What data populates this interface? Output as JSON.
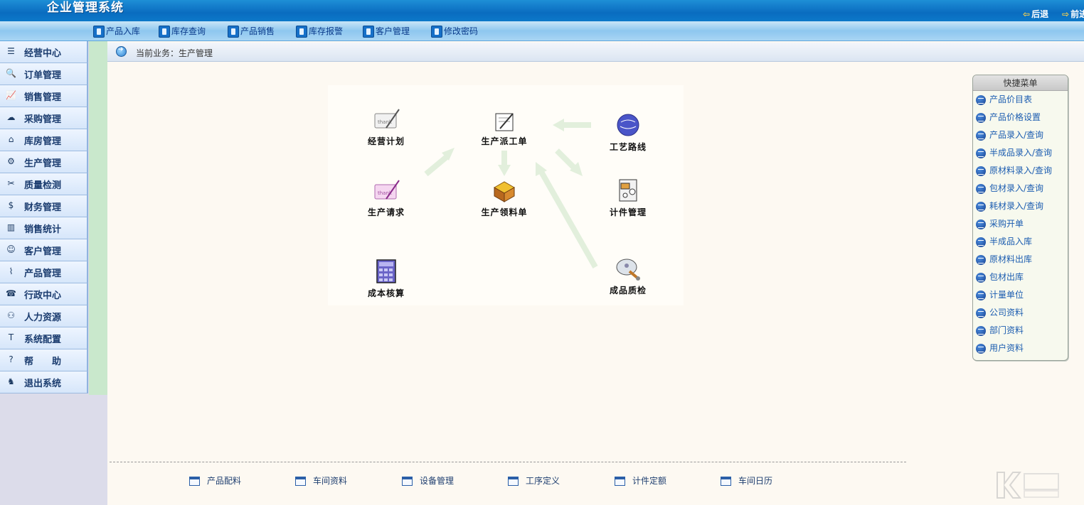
{
  "header": {
    "app_title": "企业管理系统",
    "back_label": "后退",
    "forward_label": "前进"
  },
  "toolbar": {
    "items": [
      {
        "label": "产品入库",
        "icon": "document-icon"
      },
      {
        "label": "库存查询",
        "icon": "users-icon"
      },
      {
        "label": "产品销售",
        "icon": "document-icon"
      },
      {
        "label": "库存报警",
        "icon": "document-icon"
      },
      {
        "label": "客户管理",
        "icon": "users-icon"
      },
      {
        "label": "修改密码",
        "icon": "key-icon"
      }
    ]
  },
  "sidebar": {
    "items": [
      {
        "label": "经营中心",
        "icon": "☰"
      },
      {
        "label": "订单管理",
        "icon": "🔍"
      },
      {
        "label": "销售管理",
        "icon": "📈"
      },
      {
        "label": "采购管理",
        "icon": "☁"
      },
      {
        "label": "库房管理",
        "icon": "⌂"
      },
      {
        "label": "生产管理",
        "icon": "⚙"
      },
      {
        "label": "质量检测",
        "icon": "✂"
      },
      {
        "label": "财务管理",
        "icon": "$"
      },
      {
        "label": "销售统计",
        "icon": "▥"
      },
      {
        "label": "客户管理",
        "icon": "☺"
      },
      {
        "label": "产品管理",
        "icon": "⌇"
      },
      {
        "label": "行政中心",
        "icon": "☎"
      },
      {
        "label": "人力资源",
        "icon": "⚇"
      },
      {
        "label": "系统配置",
        "icon": "T"
      },
      {
        "label": "帮　　助",
        "icon": "?"
      },
      {
        "label": "退出系统",
        "icon": "♞"
      }
    ]
  },
  "breadcrumb": {
    "text": "当前业务：生产管理"
  },
  "diagram": {
    "nodes": [
      {
        "id": "plan",
        "label": "经营计划"
      },
      {
        "id": "dispatch",
        "label": "生产派工单"
      },
      {
        "id": "route",
        "label": "工艺路线"
      },
      {
        "id": "request",
        "label": "生产请求"
      },
      {
        "id": "material",
        "label": "生产领料单"
      },
      {
        "id": "piece",
        "label": "计件管理"
      },
      {
        "id": "cost",
        "label": "成本核算"
      },
      {
        "id": "qc",
        "label": "成品质检"
      }
    ]
  },
  "quick_menu": {
    "title": "快捷菜单",
    "items": [
      "产品价目表",
      "产品价格设置",
      "产品录入/查询",
      "半成品录入/查询",
      "原材料录入/查询",
      "包材录入/查询",
      "耗材录入/查询",
      "采购开单",
      "半成品入库",
      "原材料出库",
      "包材出库",
      "计量单位",
      "公司资料",
      "部门资料",
      "用户资料"
    ]
  },
  "bottom_links": [
    "产品配料",
    "车间资料",
    "设备管理",
    "工序定义",
    "计件定额",
    "车间日历"
  ],
  "colors": {
    "header_blue": "#0a6cc0",
    "toolbar_blue": "#8ec7ef",
    "menu_text": "#1b3c6f",
    "quick_link": "#1b5cb0",
    "arrow_green": "#e2efdc"
  }
}
